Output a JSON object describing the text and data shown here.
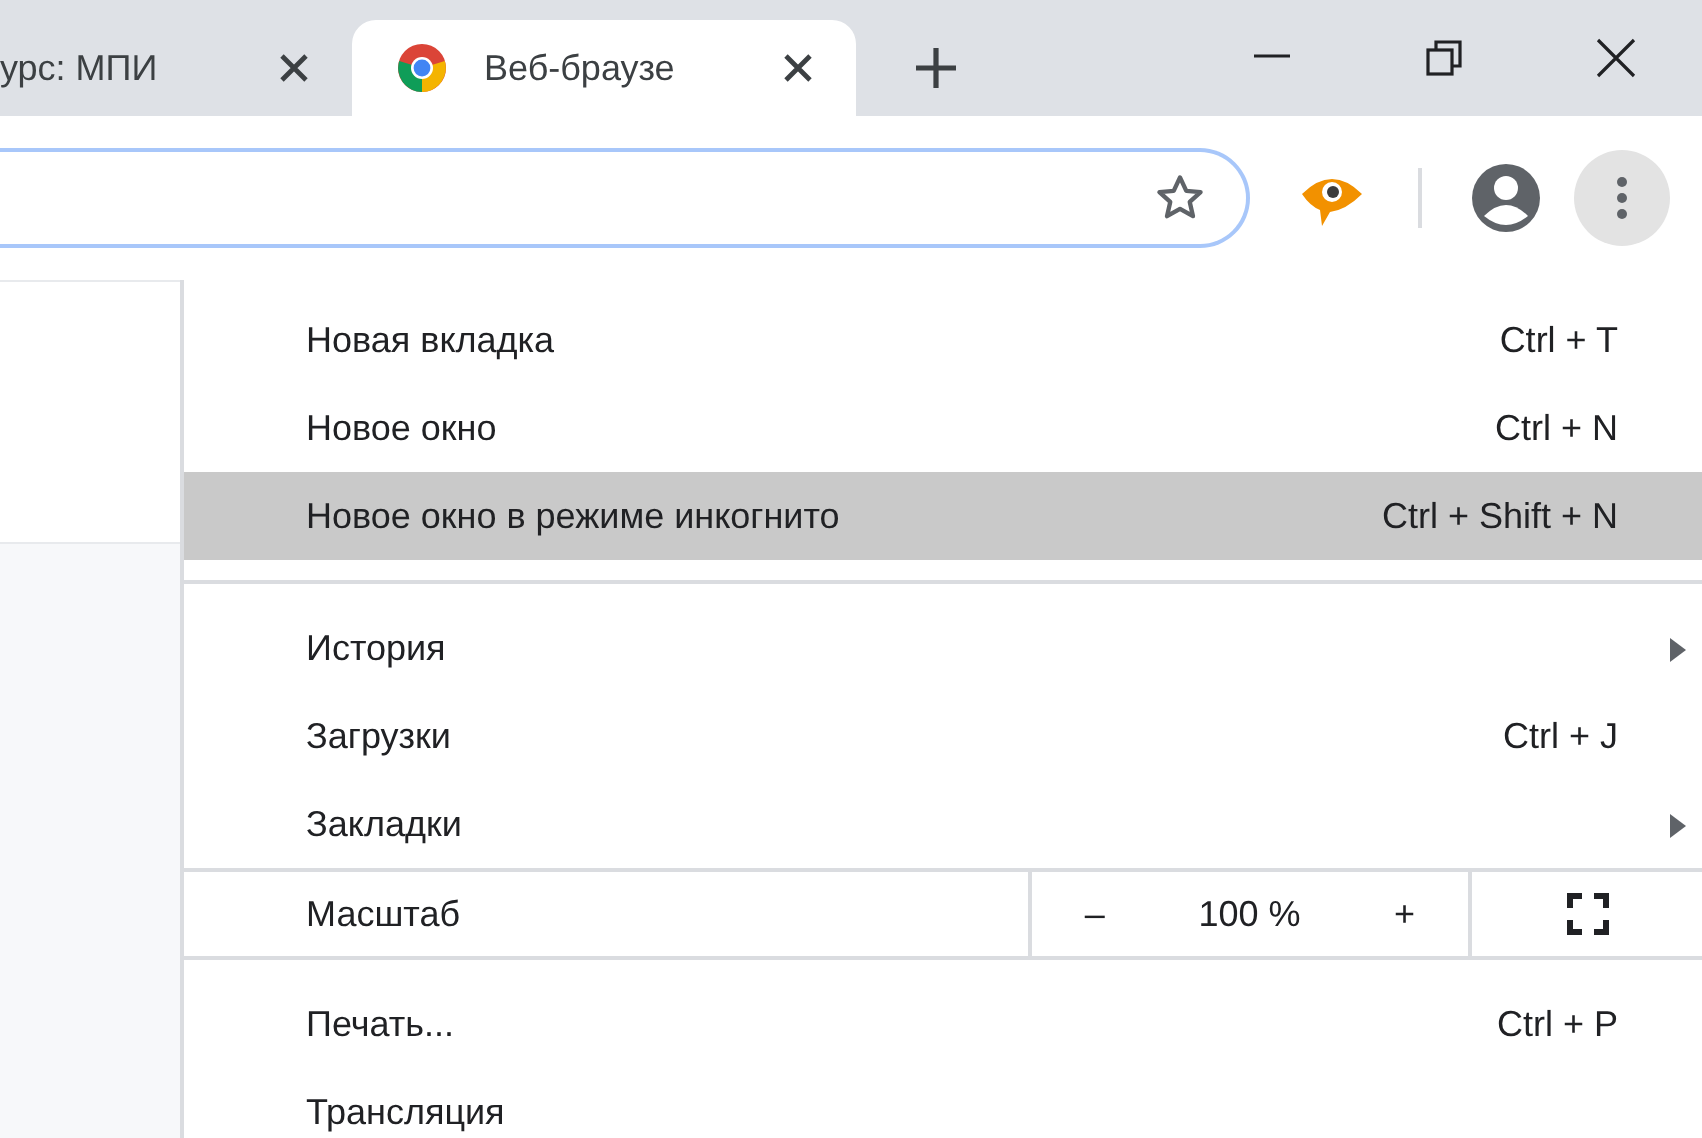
{
  "tabs": [
    {
      "title": "урс: МПИ",
      "selected": false,
      "favicon": false
    },
    {
      "title": "Веб-браузе",
      "selected": true,
      "favicon": true
    }
  ],
  "menu": [
    {
      "kind": "item",
      "label": "Новая вкладка",
      "shortcut": "Ctrl + T",
      "submenu": false,
      "highlighted": false
    },
    {
      "kind": "item",
      "label": "Новое окно",
      "shortcut": "Ctrl + N",
      "submenu": false,
      "highlighted": false
    },
    {
      "kind": "item",
      "label": "Новое окно в режиме инкогнито",
      "shortcut": "Ctrl + Shift + N",
      "submenu": false,
      "highlighted": true
    },
    {
      "kind": "separator"
    },
    {
      "kind": "item",
      "label": "История",
      "submenu": true,
      "highlighted": false
    },
    {
      "kind": "item",
      "label": "Загрузки",
      "shortcut": "Ctrl + J",
      "submenu": false,
      "highlighted": false
    },
    {
      "kind": "item",
      "label": "Закладки",
      "submenu": true,
      "highlighted": false
    },
    {
      "kind": "zoom",
      "label": "Масштаб",
      "minus": "–",
      "value": "100 %",
      "plus": "+"
    },
    {
      "kind": "item",
      "label": "Печать...",
      "shortcut": "Ctrl + P",
      "submenu": false,
      "highlighted": false
    },
    {
      "kind": "item",
      "label": "Трансляция",
      "submenu": false,
      "highlighted": false
    }
  ]
}
